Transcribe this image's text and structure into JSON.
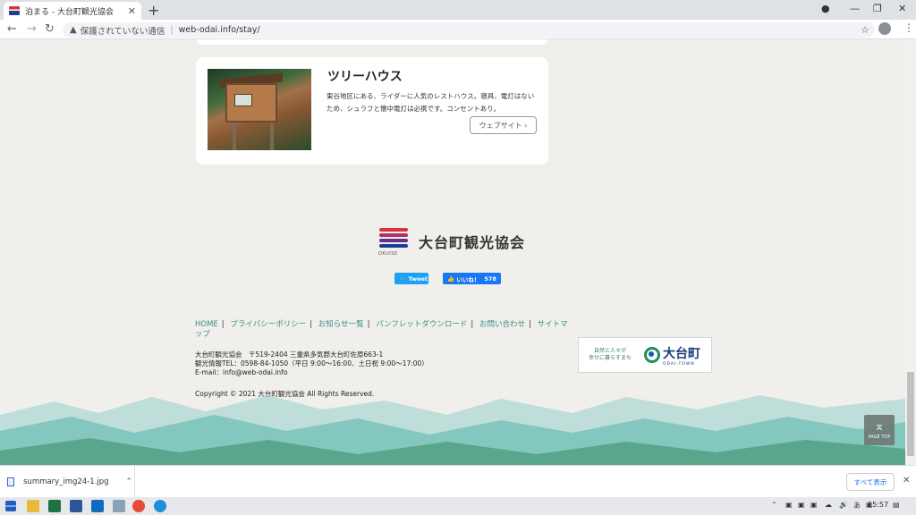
{
  "browser": {
    "tab_title": "泊まる - 大台町観光協会",
    "tab_close": "✕",
    "new_tab": "+",
    "back": "←",
    "forward": "→",
    "reload": "↻",
    "insecure_label": "保護されていない通信",
    "url": "web-odai.info/stay/",
    "star": "☆",
    "menu": "⋮",
    "window_minimize": "—",
    "window_restore": "❐",
    "window_close": "✕"
  },
  "listing": {
    "name": "ツリーハウス",
    "description": "東谷地区にある、ライダーに人気のレストハウス。寝具、電灯はないため、シュラフと懐中電灯は必携です。コンセントあり。",
    "website_button": "ウェブサイト ›"
  },
  "footer": {
    "logo_sub": "OKUISE",
    "org_name": "大台町観光協会",
    "tweet_label": "Tweet",
    "like_label": "いいね！",
    "like_count": "578",
    "links": [
      {
        "label": "HOME"
      },
      {
        "label": "プライバシーポリシー"
      },
      {
        "label": "お知らせ一覧"
      },
      {
        "label": "パンフレットダウンロード"
      },
      {
        "label": "お問い合わせ"
      },
      {
        "label": "サイトマップ"
      }
    ],
    "address_line1": "大台町観光協会　〒519-2404 三重県多気郡大台町佐原663-1",
    "address_line2": "観光情報TEL：0598-84-1050（平日 9:00～16:00、土日祝 9:00～17:00）",
    "address_line3": "E-mail：info@web-odai.info",
    "copyright": "Copyright © 2021 大台町観光協会 All Rights Reserved.",
    "banner_tag_line1": "自然と人々が",
    "banner_tag_line2": "幸せに暮らすまち",
    "banner_town": "大台町",
    "banner_town_sub": "ODAI-TOWN",
    "pagetop_arrow": "⌅",
    "pagetop_label": "PAGE TOP"
  },
  "downloads": {
    "file_name": "summary_img24-1.jpg",
    "chevron": "⌃",
    "show_all": "すべて表示",
    "close": "✕"
  },
  "taskbar": {
    "ime": "あ",
    "clock": "15:57"
  },
  "colors": {
    "link": "#3a8f86",
    "tweet": "#1da1f2",
    "like": "#1877f2",
    "logo_red": "#d8323c",
    "logo_blue": "#1c3f95"
  }
}
